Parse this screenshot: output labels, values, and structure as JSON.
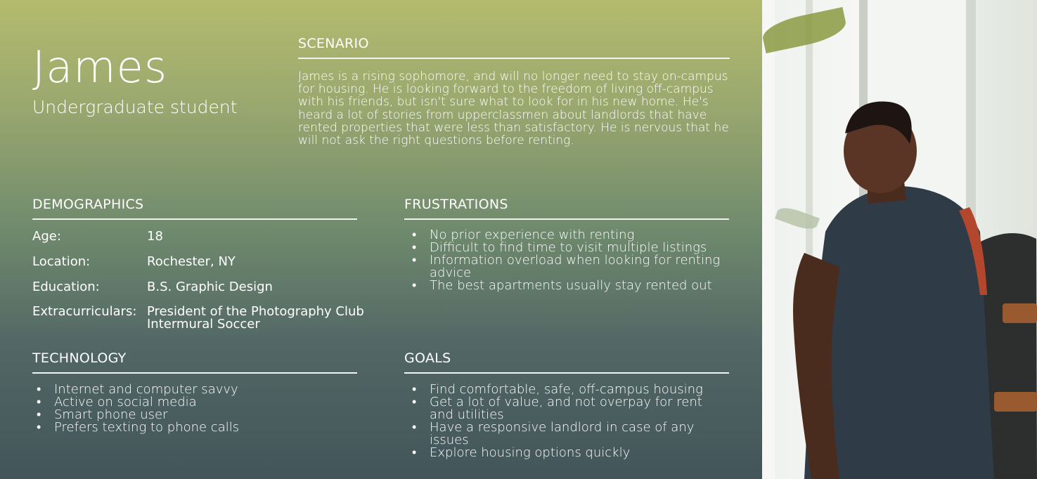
{
  "persona": {
    "name": "James",
    "role": "Undergraduate student"
  },
  "scenario": {
    "title": "SCENARIO",
    "text": "James is a rising sophomore, and will no longer need to stay on-campus for housing. He is looking forward to the freedom of living off-campus with his friends, but isn't sure what to look for in his new home. He's heard a lot of stories from upperclassmen about landlords that have rented properties that were less than satisfactory. He is nervous that he will not ask the right questions before renting."
  },
  "demographics": {
    "title": "DEMOGRAPHICS",
    "rows": [
      {
        "label": "Age:",
        "value": "18"
      },
      {
        "label": "Location:",
        "value": "Rochester, NY"
      },
      {
        "label": "Education:",
        "value": "B.S. Graphic Design"
      },
      {
        "label": "Extracurriculars:",
        "value": "President of the Photography Club",
        "value2": "Intermural Soccer"
      }
    ]
  },
  "frustrations": {
    "title": "FRUSTRATIONS",
    "items": [
      "No prior experience with renting",
      "Difficult to find time to visit multiple listings",
      "Information overload when looking for renting advice",
      "The best apartments usually stay rented out"
    ]
  },
  "technology": {
    "title": "TECHNOLOGY",
    "items": [
      "Internet and computer savvy",
      "Active on social media",
      "Smart phone user",
      "Prefers texting to phone calls"
    ]
  },
  "goals": {
    "title": "GOALS",
    "items": [
      "Find comfortable, safe, off-campus housing",
      "Get a lot of value, and not overpay for rent and utilities",
      "Have a responsive landlord in case of any issues",
      "Explore housing options quickly"
    ]
  },
  "bullet_glyph": "•",
  "colors": {
    "panel_top": "#b4bb6e",
    "panel_bottom": "#435559",
    "text": "#ffffff"
  }
}
